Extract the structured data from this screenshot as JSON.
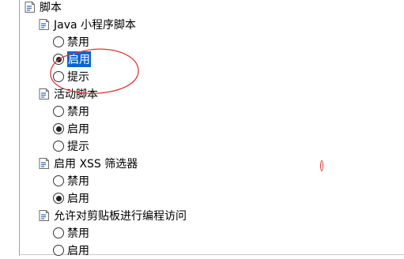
{
  "accent_color": "#0a64d0",
  "annotation_color": "#d9383a",
  "root": {
    "label": "脚本",
    "icon": "settings-script-icon"
  },
  "groups": [
    {
      "label": "Java 小程序脚本",
      "icon": "settings-script-icon",
      "options": [
        {
          "label": "禁用",
          "selected": false
        },
        {
          "label": "启用",
          "selected": true,
          "highlighted": true
        },
        {
          "label": "提示",
          "selected": false
        }
      ]
    },
    {
      "label": "活动脚本",
      "icon": "settings-script-icon",
      "options": [
        {
          "label": "禁用",
          "selected": false
        },
        {
          "label": "启用",
          "selected": true
        },
        {
          "label": "提示",
          "selected": false
        }
      ]
    },
    {
      "label": "启用 XSS 筛选器",
      "icon": "settings-script-icon",
      "options": [
        {
          "label": "禁用",
          "selected": false
        },
        {
          "label": "启用",
          "selected": true
        }
      ]
    },
    {
      "label": "允许对剪贴板进行编程访问",
      "icon": "settings-script-icon",
      "options": [
        {
          "label": "禁用",
          "selected": false
        },
        {
          "label": "启用",
          "selected": false
        }
      ]
    }
  ]
}
